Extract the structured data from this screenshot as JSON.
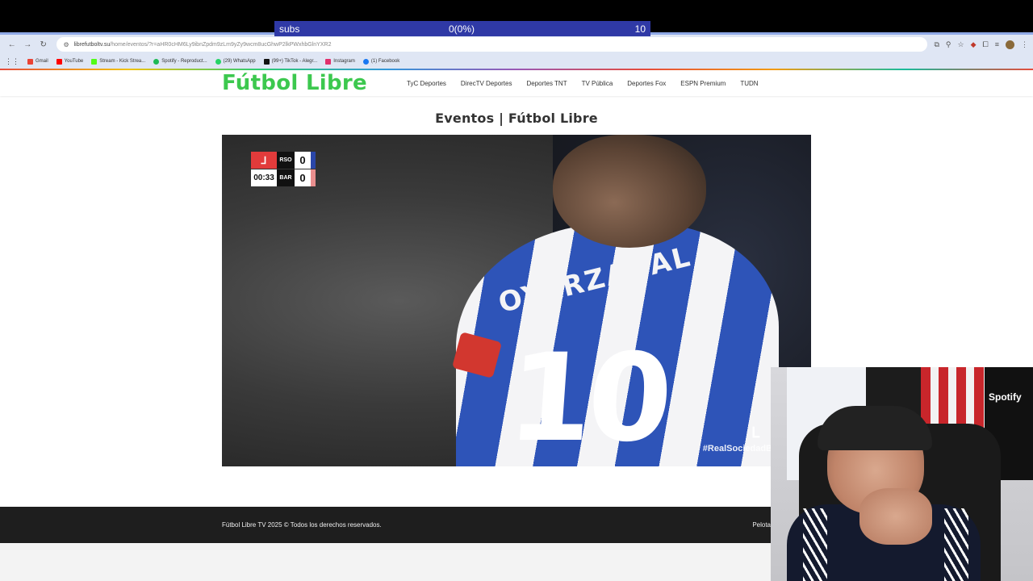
{
  "overlay": {
    "subs_label": "subs",
    "subs_progress": "0(0%)",
    "subs_goal": "10"
  },
  "browser": {
    "url_host": "librefutboltv.su",
    "url_path": "/home/eventos/?r=aHR0cHM6Ly9ibnZpdm9zLm9yZy9wcm8ucGhwP2lkPWxhbGlnYXR2",
    "bookmarks": [
      {
        "label": "Gmail",
        "color": "#ea4335"
      },
      {
        "label": "YouTube",
        "color": "#ff0000"
      },
      {
        "label": "Stream - Kick Strea...",
        "color": "#53fc18"
      },
      {
        "label": "Spotify - Reproduct...",
        "color": "#1db954"
      },
      {
        "label": "(29) WhatsApp",
        "color": "#25d366"
      },
      {
        "label": "(99+) TikTok - Alegr...",
        "color": "#111111"
      },
      {
        "label": "Instagram",
        "color": "#e1306c"
      },
      {
        "label": "(1) Facebook",
        "color": "#1877f2"
      }
    ]
  },
  "site": {
    "logo": "Fútbol Libre",
    "logo_color": "#3cc84e",
    "nav": [
      "TyC Deportes",
      "DirecTV Deportes",
      "Deportes TNT",
      "TV Pública",
      "Deportes Fox",
      "ESPN Premium",
      "TUDN"
    ],
    "page_title": "Eventos | Fútbol Libre"
  },
  "video": {
    "scoreboard": {
      "clock": "00:33",
      "home_team": "RSO",
      "home_score": "0",
      "away_team": "BAR",
      "away_score": "0"
    },
    "shirt_number": "10",
    "shirt_name": "OYARZABAL",
    "hashtag": "#RealSociedadB"
  },
  "footer": {
    "copyright": "Fútbol Libre TV 2025 © Todos los derechos reservados.",
    "right_text": "Pelota"
  },
  "webcam": {
    "jersey_sponsor": "Spotify"
  }
}
